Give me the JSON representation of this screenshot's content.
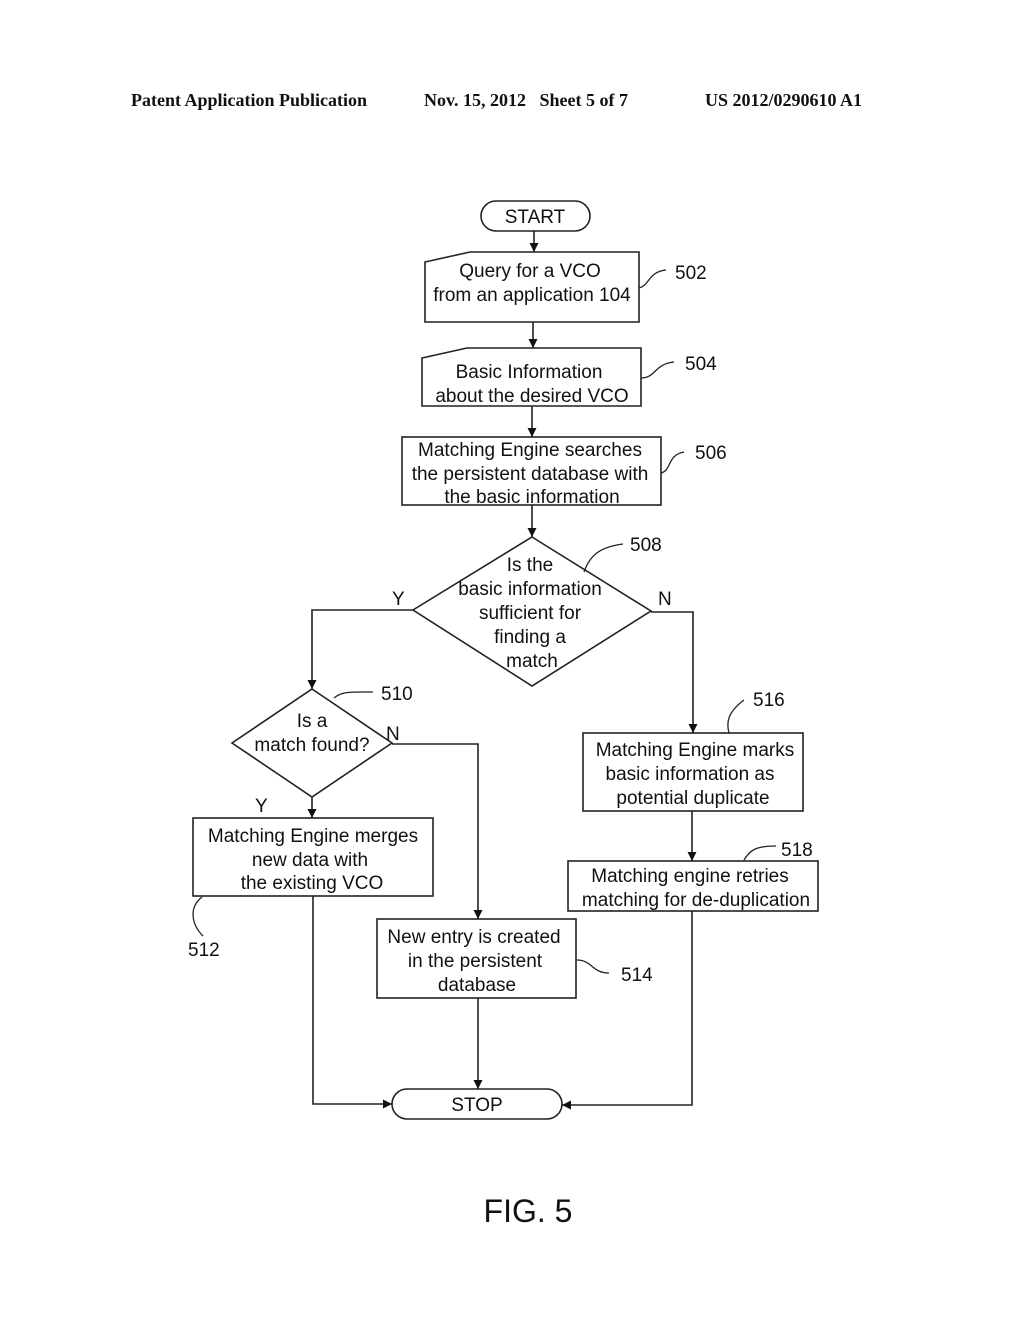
{
  "header": {
    "publication": "Patent Application Publication",
    "date_sheet": "Nov. 15, 2012   Sheet 5 of 7",
    "number": "US 2012/0290610 A1"
  },
  "figure_label": "FIG. 5",
  "nodes": {
    "start": {
      "type": "terminal",
      "lines": [
        "START"
      ]
    },
    "n502": {
      "type": "manual-input",
      "ref": "502",
      "lines": [
        "Query for a VCO",
        "from an application 104"
      ]
    },
    "n504": {
      "type": "manual-input",
      "ref": "504",
      "lines": [
        "Basic Information",
        "about the desired VCO"
      ]
    },
    "n506": {
      "type": "process",
      "ref": "506",
      "lines": [
        "Matching Engine searches",
        "the persistent database with",
        "the basic information"
      ]
    },
    "n508": {
      "type": "decision",
      "ref": "508",
      "lines": [
        "Is the",
        "basic information",
        "sufficient for",
        "finding a",
        "match"
      ]
    },
    "n510": {
      "type": "decision",
      "ref": "510",
      "lines": [
        "Is a",
        "match found?"
      ]
    },
    "n512": {
      "type": "process",
      "ref": "512",
      "lines": [
        "Matching Engine merges",
        "new data with",
        "the existing VCO"
      ]
    },
    "n514": {
      "type": "process",
      "ref": "514",
      "lines": [
        "New entry is created",
        "in the persistent",
        "database"
      ]
    },
    "n516": {
      "type": "process",
      "ref": "516",
      "lines": [
        "Matching Engine marks",
        "basic information as",
        "potential duplicate"
      ]
    },
    "n518": {
      "type": "process",
      "ref": "518",
      "lines": [
        "Matching engine retries",
        "matching for de-duplication"
      ]
    },
    "stop": {
      "type": "terminal",
      "lines": [
        "STOP"
      ]
    }
  },
  "edges": [
    {
      "from": "start",
      "to": "n502",
      "label": ""
    },
    {
      "from": "n502",
      "to": "n504",
      "label": ""
    },
    {
      "from": "n504",
      "to": "n506",
      "label": ""
    },
    {
      "from": "n506",
      "to": "n508",
      "label": ""
    },
    {
      "from": "n508",
      "to": "n510",
      "label": "Y"
    },
    {
      "from": "n508",
      "to": "n516",
      "label": "N"
    },
    {
      "from": "n510",
      "to": "n512",
      "label": "Y"
    },
    {
      "from": "n510",
      "to": "n514",
      "label": "N"
    },
    {
      "from": "n516",
      "to": "n518",
      "label": ""
    },
    {
      "from": "n512",
      "to": "stop",
      "label": ""
    },
    {
      "from": "n514",
      "to": "stop",
      "label": ""
    },
    {
      "from": "n518",
      "to": "stop",
      "label": ""
    }
  ]
}
